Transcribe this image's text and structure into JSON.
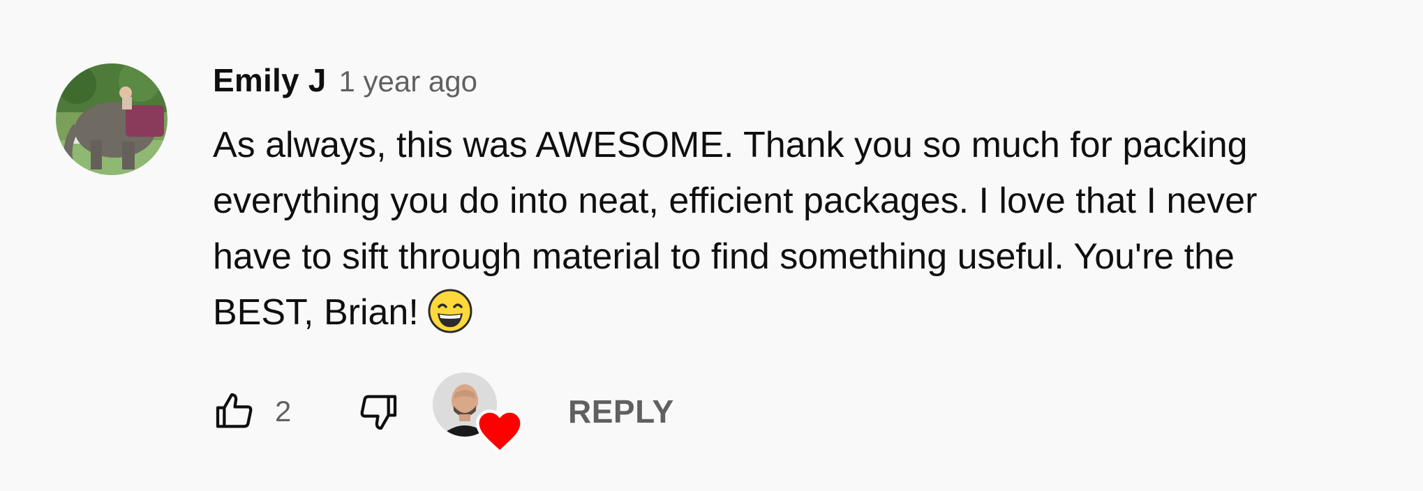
{
  "comment": {
    "author": "Emily J",
    "timestamp": "1 year ago",
    "text_lines": [
      "As always, this was AWESOME. Thank you so much for packing",
      "everything you do into neat, efficient packages. I love that I never",
      "have to sift through material to find something useful. You're the",
      "BEST, Brian!"
    ],
    "emoji": "grinning-face-with-smiling-eyes",
    "likes": "2",
    "reply_label": "REPLY",
    "hearted_by_creator": true
  },
  "icons": {
    "like": "thumbs-up-icon",
    "dislike": "thumbs-down-icon",
    "heart": "heart-icon"
  },
  "colors": {
    "background": "#f9f9f9",
    "text": "#0f0f0f",
    "secondary_text": "#606060",
    "heart": "#ff0000"
  }
}
